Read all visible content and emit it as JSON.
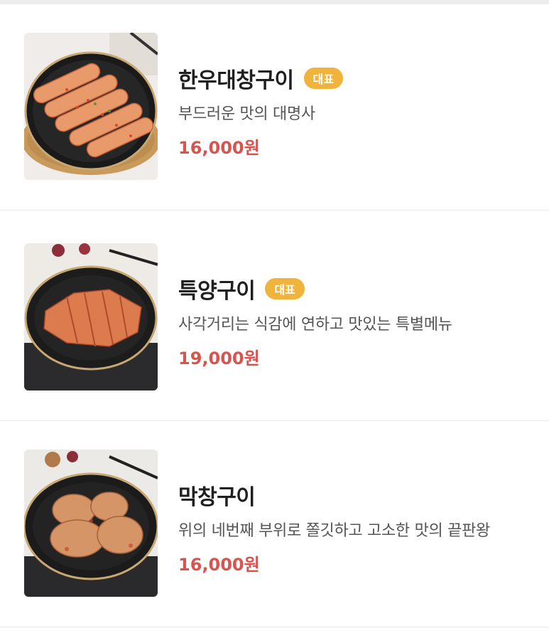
{
  "menu": {
    "items": [
      {
        "image_icon": "food-photo-grilled-beef-intestine",
        "title": "한우대창구이",
        "badge": "대표",
        "description": "부드러운 맛의 대명사",
        "price": "16,000원"
      },
      {
        "image_icon": "food-photo-grilled-tripe",
        "title": "특양구이",
        "badge": "대표",
        "description": "사각거리는 식감에 연하고 맛있는 특별메뉴",
        "price": "19,000원"
      },
      {
        "image_icon": "food-photo-grilled-makchang",
        "title": "막창구이",
        "badge": "",
        "description": "위의 네번째 부위로 쫄깃하고 고소한 맛의 끝판왕",
        "price": "16,000원"
      }
    ]
  },
  "colors": {
    "badge": "#f0b33c",
    "price": "#d9534f",
    "divider": "#e9e9e9"
  }
}
